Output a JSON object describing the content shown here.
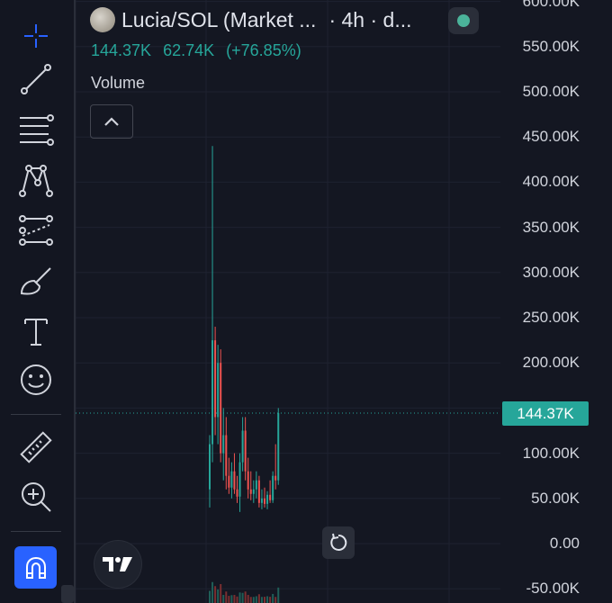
{
  "legend": {
    "title": "Lucia/SOL (Market ...",
    "interval": "· 4h · d...",
    "price_current": "144.37K",
    "price_change": "62.74K",
    "price_change_pct": "(+76.85%)",
    "volume_label": "Volume"
  },
  "toolbar": {
    "tools": [
      "crosshair-icon",
      "trend-line-icon",
      "fib-retracement-icon",
      "pattern-icon",
      "prediction-icon",
      "brush-icon",
      "text-icon",
      "emoji-icon",
      "ruler-icon",
      "zoom-in-icon",
      "magnet-icon"
    ]
  },
  "price_scale": {
    "ticks": [
      "600.00K",
      "550.00K",
      "500.00K",
      "450.00K",
      "400.00K",
      "350.00K",
      "300.00K",
      "250.00K",
      "200.00K",
      "100.00K",
      "50.00K",
      "0.00",
      "-50.00K"
    ],
    "current_price_tag": "144.37K"
  },
  "colors": {
    "background": "#141722",
    "up": "#26a69a",
    "down": "#ef5350",
    "accent": "#2962ff"
  },
  "chart_data": {
    "type": "candlestick",
    "y_range": [
      -50000,
      600000
    ],
    "current_price": 144370,
    "candles": [
      {
        "o": 60000,
        "h": 120000,
        "l": 40000,
        "c": 110000
      },
      {
        "o": 110000,
        "h": 440000,
        "l": 90000,
        "c": 225000
      },
      {
        "o": 225000,
        "h": 240000,
        "l": 120000,
        "c": 140000
      },
      {
        "o": 140000,
        "h": 220000,
        "l": 110000,
        "c": 200000
      },
      {
        "o": 200000,
        "h": 215000,
        "l": 90000,
        "c": 100000
      },
      {
        "o": 100000,
        "h": 150000,
        "l": 70000,
        "c": 120000
      },
      {
        "o": 120000,
        "h": 140000,
        "l": 60000,
        "c": 75000
      },
      {
        "o": 75000,
        "h": 95000,
        "l": 55000,
        "c": 62000
      },
      {
        "o": 62000,
        "h": 90000,
        "l": 50000,
        "c": 80000
      },
      {
        "o": 80000,
        "h": 100000,
        "l": 55000,
        "c": 60000
      },
      {
        "o": 60000,
        "h": 75000,
        "l": 45000,
        "c": 52000
      },
      {
        "o": 52000,
        "h": 100000,
        "l": 35000,
        "c": 90000
      },
      {
        "o": 90000,
        "h": 140000,
        "l": 80000,
        "c": 125000
      },
      {
        "o": 125000,
        "h": 140000,
        "l": 70000,
        "c": 80000
      },
      {
        "o": 80000,
        "h": 95000,
        "l": 50000,
        "c": 60000
      },
      {
        "o": 60000,
        "h": 80000,
        "l": 48000,
        "c": 55000
      },
      {
        "o": 55000,
        "h": 70000,
        "l": 45000,
        "c": 60000
      },
      {
        "o": 60000,
        "h": 80000,
        "l": 50000,
        "c": 70000
      },
      {
        "o": 70000,
        "h": 75000,
        "l": 40000,
        "c": 45000
      },
      {
        "o": 45000,
        "h": 60000,
        "l": 38000,
        "c": 50000
      },
      {
        "o": 50000,
        "h": 62000,
        "l": 40000,
        "c": 44000
      },
      {
        "o": 44000,
        "h": 58000,
        "l": 38000,
        "c": 54000
      },
      {
        "o": 54000,
        "h": 70000,
        "l": 45000,
        "c": 48000
      },
      {
        "o": 48000,
        "h": 80000,
        "l": 45000,
        "c": 75000
      },
      {
        "o": 75000,
        "h": 110000,
        "l": 60000,
        "c": 70000
      },
      {
        "o": 70000,
        "h": 150000,
        "l": 65000,
        "c": 144370
      }
    ]
  }
}
